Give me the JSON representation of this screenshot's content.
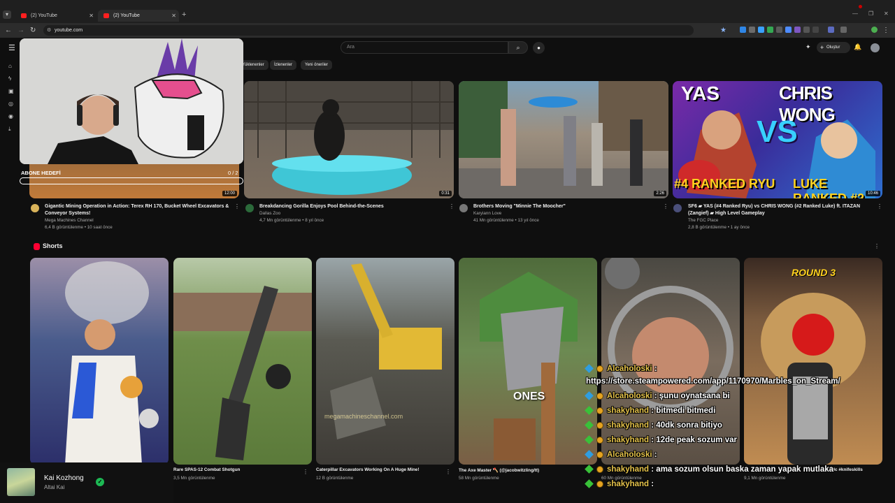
{
  "browser": {
    "tabs": [
      {
        "label": "(2) YouTube",
        "active": false
      },
      {
        "label": "(2) YouTube",
        "active": true
      }
    ],
    "url": "youtube.com"
  },
  "header": {
    "search_placeholder": "Ara",
    "create_label": "Oluştur",
    "notification_count": "9+"
  },
  "chips": [
    "Yüklenenler",
    "İzlenenler",
    "Yeni öneriler"
  ],
  "videos": [
    {
      "title": "Gigantic Mining Operation in Action: Terex RH 170, Bucket Wheel Excavators & Conveyor Systems!",
      "channel": "Mega Machines Channel",
      "stats": "6,4 B görüntülenme • 10 saat önce",
      "duration": "12:00"
    },
    {
      "title": "Breakdancing Gorilla Enjoys Pool Behind-the-Scenes",
      "channel": "Dallas Zoo",
      "stats": "4,7 Mn görüntülenme • 8 yıl önce",
      "duration": "0:31"
    },
    {
      "title": "Brothers Moving \"Minnie The Moocher\"",
      "channel": "Karyiann Love",
      "stats": "41 Mn görüntülenme • 13 yıl önce",
      "duration": "2:26"
    },
    {
      "title": "SF6 ▰ YAS (#4 Ranked Ryu) vs CHRIS WONG (#2 Ranked Luke) ft. ITAZAN (Zangief) ▰ High Level Gameplay",
      "channel": "The FGC Place",
      "stats": "2,8 B görüntülenme • 1 ay önce",
      "duration": "10:46"
    }
  ],
  "thumb_text": {
    "yas": "YAS",
    "chris": "CHRIS WONG",
    "vs": "VS",
    "rank4": "#4 RANKED RYU",
    "rank2": "LUKE RANKED #2"
  },
  "shorts": {
    "heading": "Shorts",
    "items": [
      {
        "title": "",
        "views": "",
        "overlay": ""
      },
      {
        "title": "Rare SPAS-12 Combat Shotgun",
        "views": "3,5 Mn görüntülenme",
        "overlay": ""
      },
      {
        "title": "Caterpillar Excavators Working On A Huge Mine!",
        "views": "12 B görüntülenme",
        "overlay": "megamachineschannel.com"
      },
      {
        "title": "The Axe Master 🪓 (@jacobwitzling/tt)",
        "views": "58 Mn görüntülenme",
        "overlay": "ONES"
      },
      {
        "title": "",
        "views": "60 Mn görüntülenme",
        "overlay": ""
      },
      {
        "title": "#edc #knifeskills",
        "views": "9,1 Mn görüntülenme",
        "overlay": "ROUND 3"
      }
    ]
  },
  "stream_overlay": {
    "sub_goal_label": "ABONE HEDEFİ",
    "sub_goal_count": "0 / 2"
  },
  "chat": [
    {
      "user": "Alcaholoski",
      "msg": " :",
      "badge": "blue"
    },
    {
      "user": "",
      "msg": "https://store.steampowered.com/app/1170970/Marbles_on_Stream/",
      "badge": "none"
    },
    {
      "user": "Alcaholoski",
      "msg": " : şunu oynatsana bi",
      "badge": "blue"
    },
    {
      "user": "shakyhand",
      "msg": " : bitmedi bitmedi",
      "badge": "green"
    },
    {
      "user": "shakyhand",
      "msg": " : 40dk sonra bitiyo",
      "badge": "green"
    },
    {
      "user": "shakyhand",
      "msg": " : 12de peak sozum var",
      "badge": "green"
    },
    {
      "user": "Alcaholoski",
      "msg": " :",
      "badge": "blue"
    },
    {
      "user": "shakyhand",
      "msg": " : ama sozum olsun baska zaman yapak mutlaka",
      "badge": "green"
    },
    {
      "user": "shakyhand",
      "msg": " :",
      "badge": "green"
    }
  ],
  "now_playing": {
    "title": "Kai Kozhong",
    "artist": "Altai Kai"
  },
  "colors": {
    "bg": "#0f0f0f",
    "yt_red": "#ff0033",
    "chat_user": "#e5c34b"
  }
}
